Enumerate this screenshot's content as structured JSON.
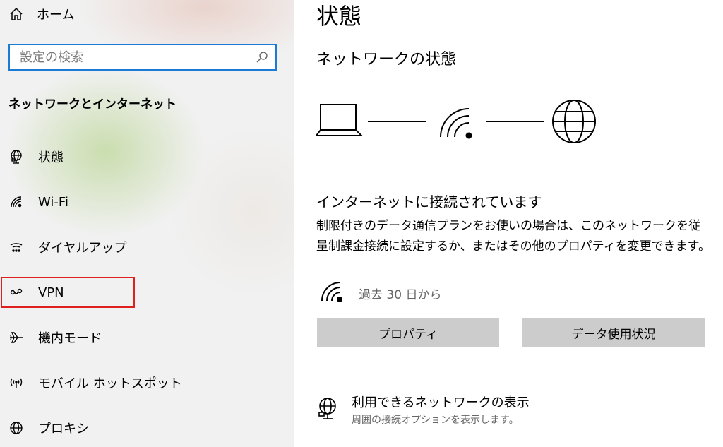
{
  "sidebar": {
    "home_label": "ホーム",
    "search_placeholder": "設定の検索",
    "section_title": "ネットワークとインターネット",
    "items": [
      {
        "label": "状態",
        "icon": "globe-network-icon"
      },
      {
        "label": "Wi-Fi",
        "icon": "wifi-icon"
      },
      {
        "label": "ダイヤルアップ",
        "icon": "dialup-icon"
      },
      {
        "label": "VPN",
        "icon": "vpn-icon"
      },
      {
        "label": "機内モード",
        "icon": "airplane-icon"
      },
      {
        "label": "モバイル ホットスポット",
        "icon": "hotspot-icon"
      },
      {
        "label": "プロキシ",
        "icon": "globe-icon"
      }
    ],
    "highlighted_item": "VPN"
  },
  "main": {
    "page_title": "状態",
    "network_status_heading": "ネットワークの状態",
    "connected_text": "インターネットに接続されています",
    "description": "制限付きのデータ通信プランをお使いの場合は、このネットワークを従量制課金接続に設定するか、またはその他のプロパティを変更できます。",
    "usage_text": "過去 30 日から",
    "buttons": {
      "properties": "プロパティ",
      "data_usage": "データ使用状況"
    },
    "available_networks": {
      "title": "利用できるネットワークの表示",
      "subtitle": "周囲の接続オプションを表示します。"
    }
  },
  "colors": {
    "search_border": "#1c7ad6",
    "highlight_border": "#e0201e",
    "button_bg": "#cccccc"
  }
}
